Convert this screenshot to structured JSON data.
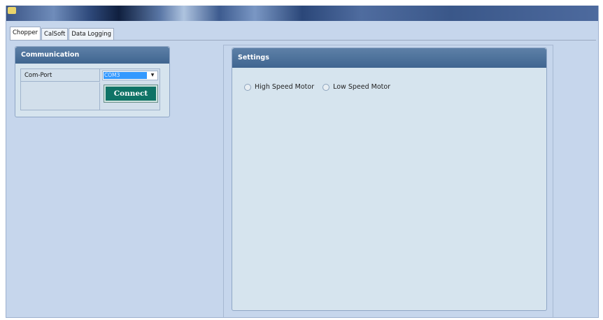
{
  "tabs": [
    "Chopper",
    "CalSoft",
    "Data Logging"
  ],
  "communication": {
    "title": "Communication",
    "com_port_label": "Com-Port",
    "com_port_value": "COM3",
    "connect_label": "Connect"
  },
  "settings": {
    "title": "Settings",
    "options": [
      "High Speed Motor",
      "Low Speed Motor"
    ]
  }
}
